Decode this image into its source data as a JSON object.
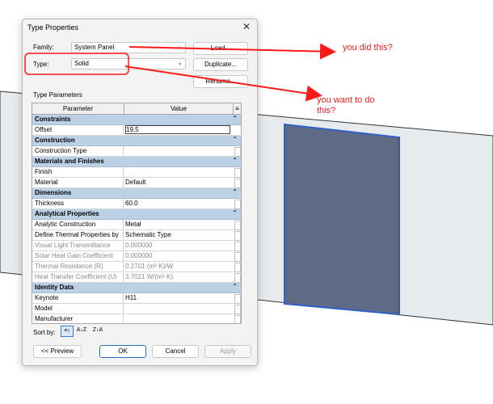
{
  "dialog": {
    "title": "Type Properties",
    "close_glyph": "✕",
    "family_label": "Family:",
    "family_value": "System Panel",
    "type_label": "Type:",
    "type_value": "Solid",
    "load_label": "Load...",
    "duplicate_label": "Duplicate...",
    "rename_label": "Rename...",
    "section_label": "Type Parameters",
    "columns": {
      "parameter": "Parameter",
      "value": "Value",
      "menu_glyph": "≡"
    }
  },
  "groups": {
    "constraints": {
      "title": "Constraints",
      "chevron": "⌃"
    },
    "construction": {
      "title": "Construction",
      "chevron": "⌃"
    },
    "materials": {
      "title": "Materials and Finishes",
      "chevron": "⌃"
    },
    "dimensions": {
      "title": "Dimensions",
      "chevron": "⌃"
    },
    "analytical": {
      "title": "Analytical Properties",
      "chevron": "⌃"
    },
    "identity": {
      "title": "Identity Data",
      "chevron": "⌃"
    }
  },
  "rows": {
    "offset": {
      "param": "Offset",
      "value": "19.5"
    },
    "construction_type": {
      "param": "Construction Type",
      "value": ""
    },
    "finish": {
      "param": "Finish",
      "value": ""
    },
    "material": {
      "param": "Material",
      "value": "Default"
    },
    "thickness": {
      "param": "Thickness",
      "value": "60.0"
    },
    "analytic_construction": {
      "param": "Analytic Construction",
      "value": "Metal"
    },
    "define_thermal": {
      "param": "Define Thermal Properties by",
      "value": "Schematic Type"
    },
    "visual_light": {
      "param": "Visual Light Transmittance",
      "value": "0.000000"
    },
    "solar_heat": {
      "param": "Solar Heat Gain Coefficient",
      "value": "0.000000"
    },
    "thermal_resistance": {
      "param": "Thermal Resistance (R)",
      "value": "0.2701 (m²·K)/W"
    },
    "heat_transfer": {
      "param": "Heat Transfer Coefficient (U)",
      "value": "3.7021 W/(m²·K)"
    },
    "keynote": {
      "param": "Keynote",
      "value": "H11"
    },
    "model": {
      "param": "Model",
      "value": ""
    },
    "manufacturer": {
      "param": "Manufacturer",
      "value": ""
    }
  },
  "footer": {
    "sort_by_label": "Sort by:",
    "sort_icons": [
      "sort-grouped-icon",
      "sort-az-icon",
      "sort-za-icon"
    ],
    "preview_label": "<< Preview",
    "ok_label": "OK",
    "cancel_label": "Cancel",
    "apply_label": "Apply"
  },
  "annotations": {
    "note1": "you did this?",
    "note2": "you want to do",
    "note3": "this?"
  },
  "colors": {
    "group_header": "#bcd0e6",
    "selected_panel": "#5f6a87",
    "panel_outline": "#2f5fc7",
    "annotation": "#ff1a1a"
  }
}
